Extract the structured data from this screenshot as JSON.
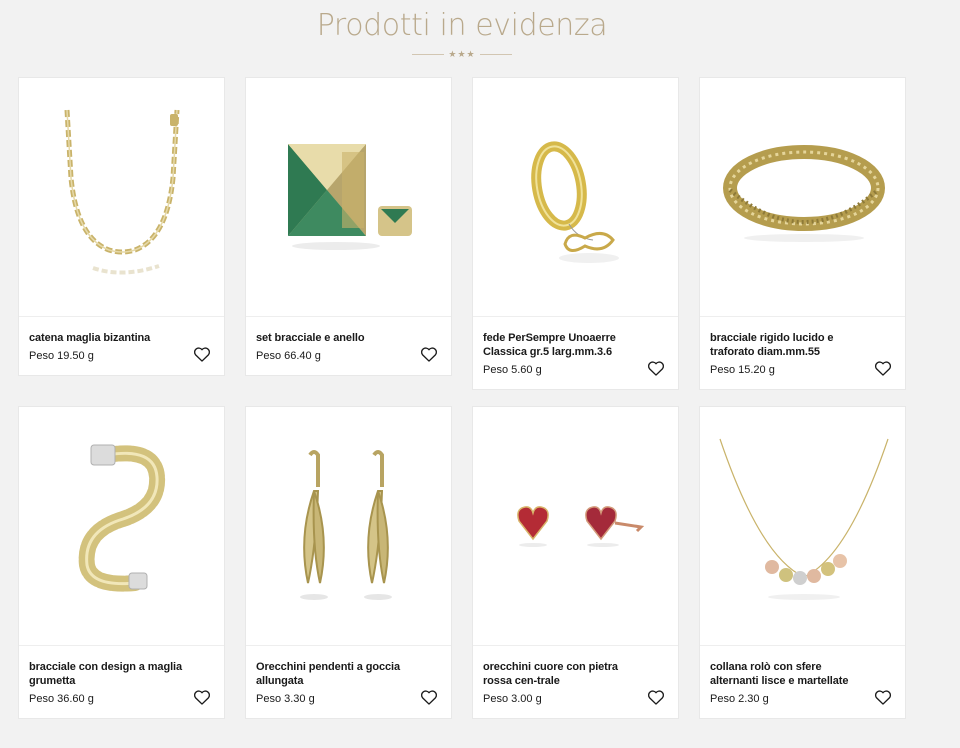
{
  "section": {
    "title": "Prodotti in evidenza",
    "ornament": "★★★"
  },
  "products": [
    {
      "name": "catena maglia bizantina",
      "weight": "Peso 19.50 g"
    },
    {
      "name": "set bracciale e anello",
      "weight": "Peso 66.40 g"
    },
    {
      "name": "fede PerSempre Unoaerre Classica gr.5 larg.mm.3.6",
      "weight": "Peso 5.60 g"
    },
    {
      "name": "bracciale rigido lucido e traforato diam.mm.55",
      "weight": "Peso 15.20 g"
    },
    {
      "name": "bracciale con design a maglia grumetta",
      "weight": "Peso 36.60 g"
    },
    {
      "name": "Orecchini pendenti a goccia allungata",
      "weight": "Peso 3.30 g"
    },
    {
      "name": "orecchini cuore con pietra rossa cen-trale",
      "weight": "Peso 3.00 g"
    },
    {
      "name": "collana rolò con sfere alternanti lisce e martellate",
      "weight": "Peso 2.30 g"
    }
  ],
  "icons": {
    "wishlist": "heart-outline-icon"
  },
  "colors": {
    "accent": "#b9a98c",
    "gold": "#c9b36a",
    "background": "#f2f2f2"
  }
}
